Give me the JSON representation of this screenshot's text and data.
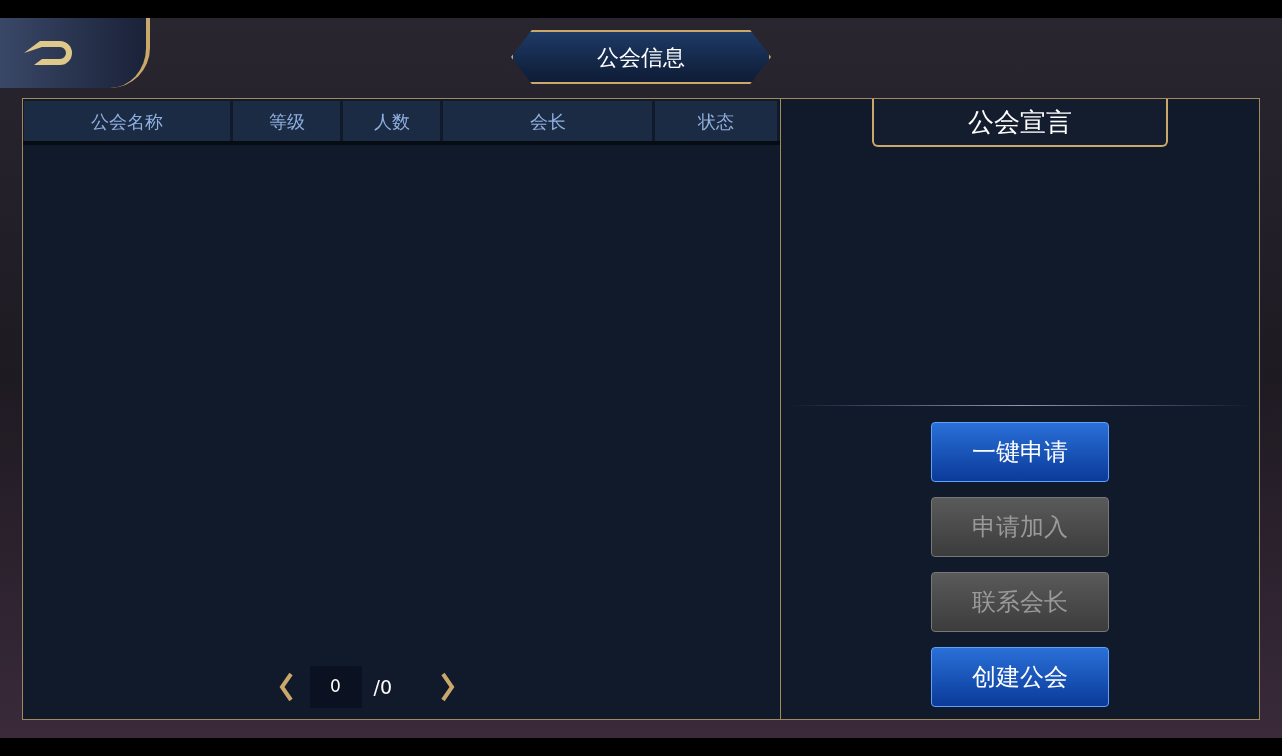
{
  "title": "公会信息",
  "table": {
    "columns": [
      "公会名称",
      "等级",
      "人数",
      "会长",
      "状态"
    ]
  },
  "pagination": {
    "current": "0",
    "total": "/0"
  },
  "declaration": {
    "title": "公会宣言"
  },
  "buttons": [
    {
      "label": "一键申请",
      "disabled": false
    },
    {
      "label": "申请加入",
      "disabled": true
    },
    {
      "label": "联系会长",
      "disabled": true
    },
    {
      "label": "创建公会",
      "disabled": false
    }
  ]
}
